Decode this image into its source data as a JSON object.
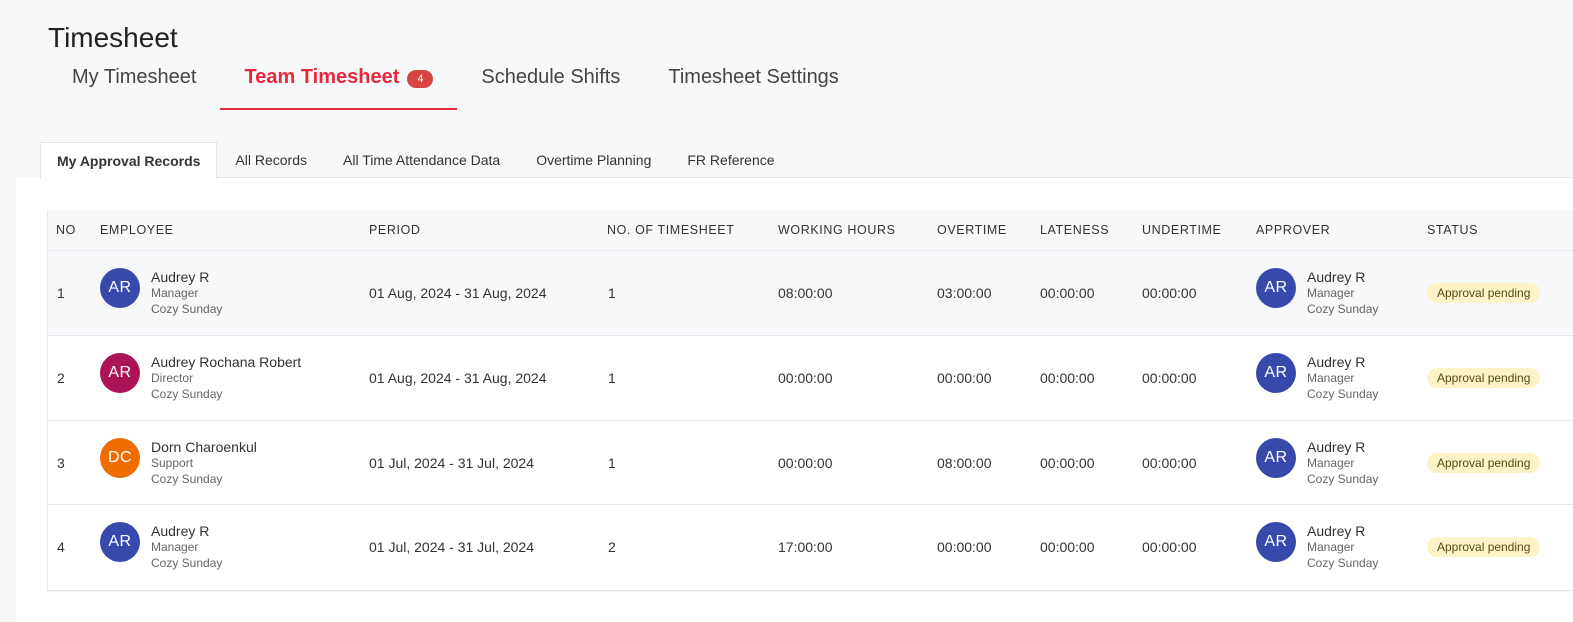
{
  "page": {
    "title": "Timesheet"
  },
  "main_tabs": [
    {
      "label": "My Timesheet"
    },
    {
      "label": "Team Timesheet",
      "badge": "4"
    },
    {
      "label": "Schedule Shifts"
    },
    {
      "label": "Timesheet Settings"
    }
  ],
  "sub_tabs": [
    {
      "label": "My Approval Records"
    },
    {
      "label": "All Records"
    },
    {
      "label": "All Time Attendance Data"
    },
    {
      "label": "Overtime Planning"
    },
    {
      "label": "FR Reference"
    }
  ],
  "table": {
    "headers": {
      "no": "NO",
      "employee": "EMPLOYEE",
      "period": "PERIOD",
      "num_timesheet": "NO. OF TIMESHEET",
      "working_hours": "WORKING HOURS",
      "overtime": "OVERTIME",
      "lateness": "LATENESS",
      "undertime": "UNDERTIME",
      "approver": "APPROVER",
      "status": "STATUS"
    },
    "rows": [
      {
        "no": "1",
        "employee": {
          "initials": "AR",
          "avatar_color": "#3949ab",
          "name": "Audrey R",
          "role": "Manager",
          "company": "Cozy Sunday"
        },
        "period": "01 Aug, 2024 - 31 Aug, 2024",
        "num_timesheet": "1",
        "working_hours": "08:00:00",
        "overtime": "03:00:00",
        "lateness": "00:00:00",
        "undertime": "00:00:00",
        "approver": {
          "initials": "AR",
          "avatar_color": "#3949ab",
          "name": "Audrey R",
          "role": "Manager",
          "company": "Cozy Sunday"
        },
        "status": "Approval pending"
      },
      {
        "no": "2",
        "employee": {
          "initials": "AR",
          "avatar_color": "#ad1457",
          "name": "Audrey Rochana Robert",
          "role": "Director",
          "company": "Cozy Sunday"
        },
        "period": "01 Aug, 2024 - 31 Aug, 2024",
        "num_timesheet": "1",
        "working_hours": "00:00:00",
        "overtime": "00:00:00",
        "lateness": "00:00:00",
        "undertime": "00:00:00",
        "approver": {
          "initials": "AR",
          "avatar_color": "#3949ab",
          "name": "Audrey R",
          "role": "Manager",
          "company": "Cozy Sunday"
        },
        "status": "Approval pending"
      },
      {
        "no": "3",
        "employee": {
          "initials": "DC",
          "avatar_color": "#ef6c00",
          "name": "Dorn Charoenkul",
          "role": "Support",
          "company": "Cozy Sunday"
        },
        "period": "01 Jul, 2024 - 31 Jul, 2024",
        "num_timesheet": "1",
        "working_hours": "00:00:00",
        "overtime": "08:00:00",
        "lateness": "00:00:00",
        "undertime": "00:00:00",
        "approver": {
          "initials": "AR",
          "avatar_color": "#3949ab",
          "name": "Audrey R",
          "role": "Manager",
          "company": "Cozy Sunday"
        },
        "status": "Approval pending"
      },
      {
        "no": "4",
        "employee": {
          "initials": "AR",
          "avatar_color": "#3949ab",
          "name": "Audrey R",
          "role": "Manager",
          "company": "Cozy Sunday"
        },
        "period": "01 Jul, 2024 - 31 Jul, 2024",
        "num_timesheet": "2",
        "working_hours": "17:00:00",
        "overtime": "00:00:00",
        "lateness": "00:00:00",
        "undertime": "00:00:00",
        "approver": {
          "initials": "AR",
          "avatar_color": "#3949ab",
          "name": "Audrey R",
          "role": "Manager",
          "company": "Cozy Sunday"
        },
        "status": "Approval pending"
      }
    ]
  },
  "colors": {
    "accent": "#e8293b",
    "badge": "#d64541",
    "status_pending_bg": "#fdf3c7"
  }
}
